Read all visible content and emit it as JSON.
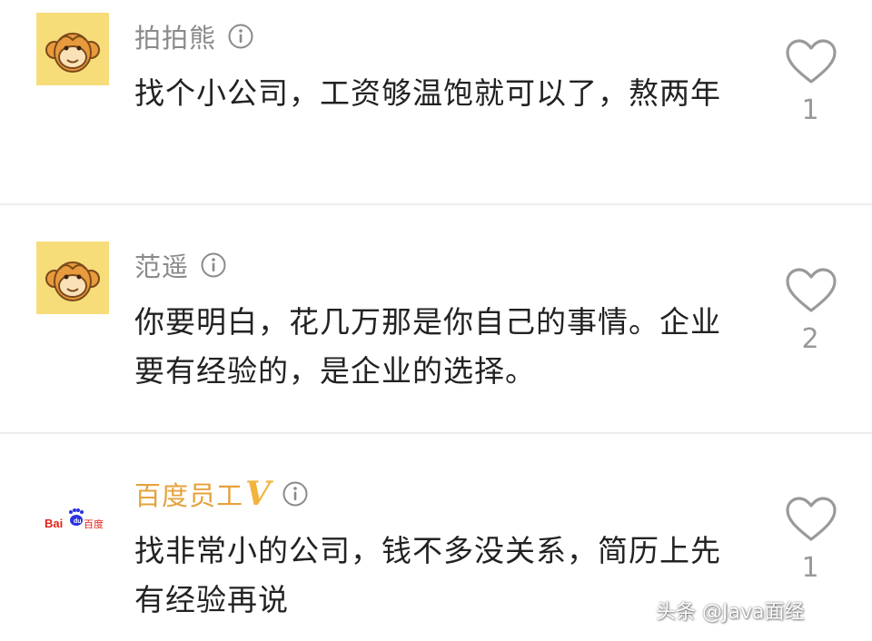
{
  "comments": [
    {
      "username": "拍拍熊",
      "text": "找个小公司，工资够温饱就可以了，熬两年",
      "like_count": "1",
      "avatar_icon": "monkey-icon",
      "avatar_bg": "#f7dc7a"
    },
    {
      "username": "范遥",
      "text": "你要明白，花几万那是你自己的事情。企业要有经验的，是企业的选择。",
      "like_count": "2",
      "avatar_icon": "monkey-icon",
      "avatar_bg": "#f7dc7a"
    },
    {
      "username": "百度员工",
      "verified_badge": "V",
      "text": "找非常小的公司，钱不多没关系，简历上先有经验再说",
      "like_count": "1",
      "avatar_icon": "baidu-logo-icon",
      "avatar_logo_text": "Bai百度",
      "username_color": "#e6a23a"
    }
  ],
  "watermark": "头条 @Java面经"
}
